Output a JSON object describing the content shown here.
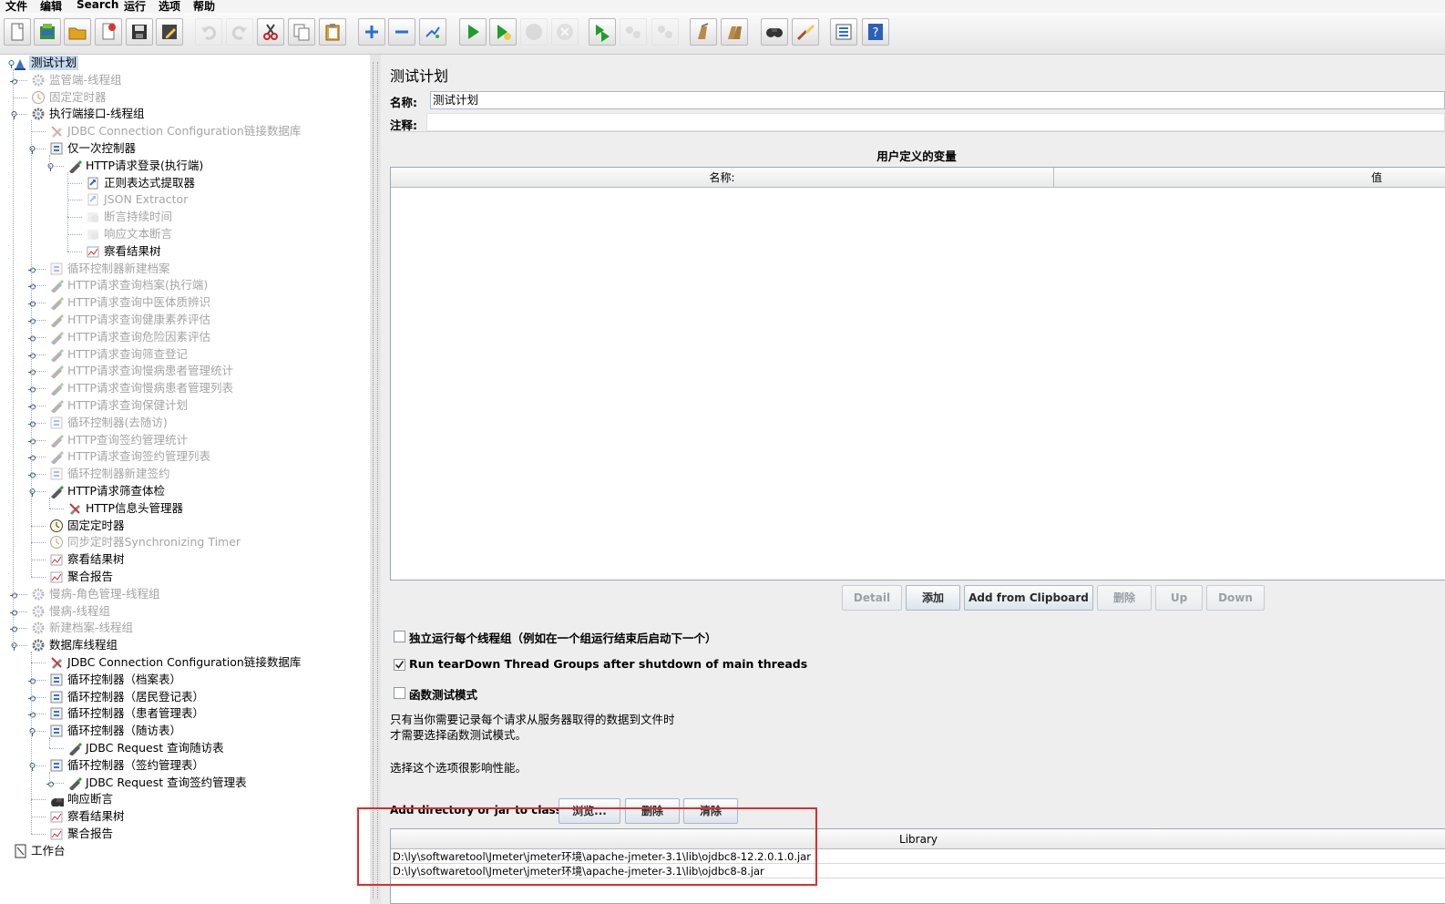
{
  "menu": [
    "文件",
    "编辑",
    "Search",
    "运行",
    "选项",
    "帮助"
  ],
  "toolbar_icons": [
    "new-icon",
    "templates-icon",
    "open-icon",
    "close-icon",
    "save-icon",
    "save-as-icon",
    "undo-icon",
    "redo-icon",
    "cut-icon",
    "copy-icon",
    "paste-icon",
    "expand-icon",
    "collapse-icon",
    "toggle-icon",
    "start-icon",
    "start-no-pause-icon",
    "stop-icon",
    "shutdown-icon",
    "remote-start-icon",
    "remote-stop-icon",
    "remote-exit-icon",
    "clear-icon",
    "clear-all-icon",
    "search-icon",
    "reset-search-icon",
    "function-helper-icon",
    "help-icon"
  ],
  "tree": [
    {
      "label": "测试计划",
      "icon": "test-plan-icon",
      "level": 0,
      "toggle": "open",
      "state": "selected"
    },
    {
      "label": "监管端-线程组",
      "icon": "gear-icon",
      "level": 1,
      "toggle": "closed",
      "state": "dim"
    },
    {
      "label": "固定定时器",
      "icon": "timer-icon",
      "level": 1,
      "toggle": "none",
      "state": "dim"
    },
    {
      "label": "执行端接口-线程组",
      "icon": "gear-icon",
      "level": 1,
      "toggle": "open",
      "state": "normal"
    },
    {
      "label": "JDBC Connection Configuration链接数据库",
      "icon": "config-icon",
      "level": 2,
      "toggle": "none",
      "state": "dim"
    },
    {
      "label": "仅一次控制器",
      "icon": "controller-icon",
      "level": 2,
      "toggle": "open",
      "state": "normal"
    },
    {
      "label": "HTTP请求登录(执行端)",
      "icon": "sampler-icon",
      "level": 3,
      "toggle": "open",
      "state": "normal"
    },
    {
      "label": "正则表达式提取器",
      "icon": "extractor-icon",
      "level": 4,
      "toggle": "none",
      "state": "normal"
    },
    {
      "label": "JSON Extractor",
      "icon": "extractor-icon",
      "level": 4,
      "toggle": "none",
      "state": "dim"
    },
    {
      "label": "断言持续时间",
      "icon": "assertion-icon",
      "level": 4,
      "toggle": "none",
      "state": "dim"
    },
    {
      "label": "响应文本断言",
      "icon": "assertion-icon",
      "level": 4,
      "toggle": "none",
      "state": "dim"
    },
    {
      "label": "察看结果树",
      "icon": "listener-icon",
      "level": 4,
      "toggle": "none",
      "state": "normal"
    },
    {
      "label": "循环控制器新建档案",
      "icon": "controller-icon",
      "level": 2,
      "toggle": "closed",
      "state": "dim"
    },
    {
      "label": "HTTP请求查询档案(执行端)",
      "icon": "sampler-icon",
      "level": 2,
      "toggle": "closed",
      "state": "dim"
    },
    {
      "label": "HTTP请求查询中医体质辨识",
      "icon": "sampler-icon",
      "level": 2,
      "toggle": "closed",
      "state": "dim"
    },
    {
      "label": "HTTP请求查询健康素养评估",
      "icon": "sampler-icon",
      "level": 2,
      "toggle": "closed",
      "state": "dim"
    },
    {
      "label": "HTTP请求查询危险因素评估",
      "icon": "sampler-icon",
      "level": 2,
      "toggle": "closed",
      "state": "dim"
    },
    {
      "label": "HTTP请求查询筛查登记",
      "icon": "sampler-icon",
      "level": 2,
      "toggle": "closed",
      "state": "dim"
    },
    {
      "label": "HTTP请求查询慢病患者管理统计",
      "icon": "sampler-icon",
      "level": 2,
      "toggle": "closed",
      "state": "dim"
    },
    {
      "label": "HTTP请求查询慢病患者管理列表",
      "icon": "sampler-icon",
      "level": 2,
      "toggle": "closed",
      "state": "dim"
    },
    {
      "label": "HTTP请求查询保健计划",
      "icon": "sampler-icon",
      "level": 2,
      "toggle": "closed",
      "state": "dim"
    },
    {
      "label": "循环控制器(去随访)",
      "icon": "controller-icon",
      "level": 2,
      "toggle": "closed",
      "state": "dim"
    },
    {
      "label": "HTTP查询签约管理统计",
      "icon": "sampler-icon",
      "level": 2,
      "toggle": "closed",
      "state": "dim"
    },
    {
      "label": "HTTP请求查询签约管理列表",
      "icon": "sampler-icon",
      "level": 2,
      "toggle": "closed",
      "state": "dim"
    },
    {
      "label": "循环控制器新建签约",
      "icon": "controller-icon",
      "level": 2,
      "toggle": "closed",
      "state": "dim"
    },
    {
      "label": "HTTP请求筛查体检",
      "icon": "sampler-icon",
      "level": 2,
      "toggle": "open",
      "state": "normal"
    },
    {
      "label": "HTTP信息头管理器",
      "icon": "config-icon",
      "level": 3,
      "toggle": "none",
      "state": "normal"
    },
    {
      "label": "固定定时器",
      "icon": "timer-icon",
      "level": 2,
      "toggle": "none",
      "state": "normal"
    },
    {
      "label": "同步定时器Synchronizing Timer",
      "icon": "timer-icon",
      "level": 2,
      "toggle": "none",
      "state": "dim"
    },
    {
      "label": "察看结果树",
      "icon": "listener-icon",
      "level": 2,
      "toggle": "none",
      "state": "normal"
    },
    {
      "label": "聚合报告",
      "icon": "listener-icon",
      "level": 2,
      "toggle": "none",
      "state": "normal"
    },
    {
      "label": "慢病-角色管理-线程组",
      "icon": "gear-icon",
      "level": 1,
      "toggle": "closed",
      "state": "dim"
    },
    {
      "label": "慢病-线程组",
      "icon": "gear-icon",
      "level": 1,
      "toggle": "closed",
      "state": "dim"
    },
    {
      "label": "新建档案-线程组",
      "icon": "gear-icon",
      "level": 1,
      "toggle": "closed",
      "state": "dim"
    },
    {
      "label": "数据库线程组",
      "icon": "gear-icon",
      "level": 1,
      "toggle": "open",
      "state": "normal"
    },
    {
      "label": "JDBC Connection Configuration链接数据库",
      "icon": "config-icon",
      "level": 2,
      "toggle": "none",
      "state": "normal"
    },
    {
      "label": "循环控制器（档案表）",
      "icon": "controller-icon",
      "level": 2,
      "toggle": "closed",
      "state": "normal"
    },
    {
      "label": "循环控制器（居民登记表）",
      "icon": "controller-icon",
      "level": 2,
      "toggle": "closed",
      "state": "normal"
    },
    {
      "label": "循环控制器（患者管理表）",
      "icon": "controller-icon",
      "level": 2,
      "toggle": "closed",
      "state": "normal"
    },
    {
      "label": "循环控制器（随访表）",
      "icon": "controller-icon",
      "level": 2,
      "toggle": "open",
      "state": "normal"
    },
    {
      "label": "JDBC Request 查询随访表",
      "icon": "sampler-icon",
      "level": 3,
      "toggle": "none",
      "state": "normal"
    },
    {
      "label": "循环控制器（签约管理表）",
      "icon": "controller-icon",
      "level": 2,
      "toggle": "open",
      "state": "normal"
    },
    {
      "label": "JDBC Request 查询签约管理表",
      "icon": "sampler-icon",
      "level": 3,
      "toggle": "closed",
      "state": "normal"
    },
    {
      "label": "响应断言",
      "icon": "search-icon",
      "level": 2,
      "toggle": "none",
      "state": "normal"
    },
    {
      "label": "察看结果树",
      "icon": "listener-icon",
      "level": 2,
      "toggle": "none",
      "state": "normal"
    },
    {
      "label": "聚合报告",
      "icon": "listener-icon",
      "level": 2,
      "toggle": "none",
      "state": "normal"
    },
    {
      "label": "工作台",
      "icon": "workbench-icon",
      "level": 0,
      "toggle": "none",
      "state": "normal"
    }
  ],
  "panel": {
    "title": "测试计划",
    "name_label": "名称:",
    "name_value": "测试计划",
    "comment_label": "注释:",
    "comment_value": "",
    "vars_title": "用户定义的变量",
    "vars_col_name": "名称:",
    "vars_col_value": "值",
    "buttons": {
      "detail": "Detail",
      "add": "添加",
      "add_clipboard": "Add from Clipboard",
      "delete": "删除",
      "up": "Up",
      "down": "Down"
    },
    "checkbox_serial": {
      "label": "独立运行每个线程组（例如在一个组运行结束后启动下一个）",
      "checked": false
    },
    "checkbox_teardown": {
      "label": "Run tearDown Thread Groups after shutdown of main threads",
      "checked": true
    },
    "checkbox_functional": {
      "label": "函数测试模式",
      "checked": false
    },
    "help_line1": "只有当你需要记录每个请求从服务器取得的数据到文件时",
    "help_line2": "才需要选择函数测试模式。",
    "help_line3": "选择这个选项很影响性能。",
    "classpath_label": "Add directory or jar to classpath",
    "browse_btn": "浏览...",
    "delete_btn": "删除",
    "clear_btn": "清除",
    "library_header": "Library",
    "library_rows": [
      "D:\\ly\\softwaretool\\Jmeter\\jmeter环境\\apache-jmeter-3.1\\lib\\ojdbc8-12.2.0.1.0.jar",
      "D:\\ly\\softwaretool\\Jmeter\\jmeter环境\\apache-jmeter-3.1\\lib\\ojdbc8-8.jar"
    ]
  },
  "colors": {
    "selection": "#c4d9f1",
    "highlight_box": "#e32a2a",
    "dim_text": "#a5a5a5"
  }
}
